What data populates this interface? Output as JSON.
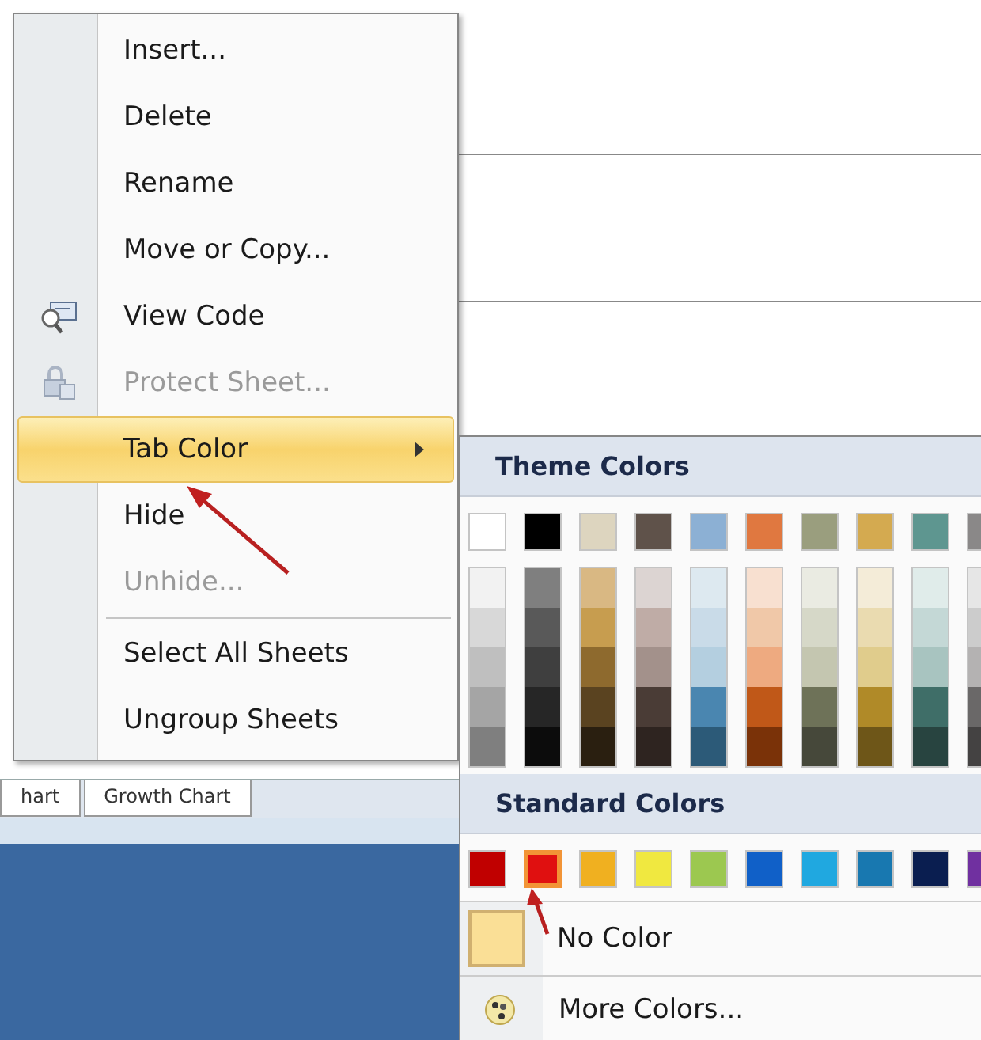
{
  "sheet_tabs": [
    {
      "label": "hart",
      "selected": false
    },
    {
      "label": "Growth Chart",
      "selected": false
    }
  ],
  "context_menu": {
    "items": [
      {
        "kind": "item",
        "label": "Insert...",
        "disabled": false,
        "selected": false,
        "has_submenu": false
      },
      {
        "kind": "item",
        "label": "Delete",
        "disabled": false,
        "selected": false,
        "has_submenu": false
      },
      {
        "kind": "item",
        "label": "Rename",
        "disabled": false,
        "selected": false,
        "has_submenu": false
      },
      {
        "kind": "item",
        "label": "Move or Copy...",
        "disabled": false,
        "selected": false,
        "has_submenu": false
      },
      {
        "kind": "item",
        "label": "View Code",
        "disabled": false,
        "selected": false,
        "has_submenu": false
      },
      {
        "kind": "item",
        "label": "Protect Sheet...",
        "disabled": true,
        "selected": false,
        "has_submenu": false
      },
      {
        "kind": "item",
        "label": "Tab Color",
        "disabled": false,
        "selected": true,
        "has_submenu": true
      },
      {
        "kind": "item",
        "label": "Hide",
        "disabled": false,
        "selected": false,
        "has_submenu": false
      },
      {
        "kind": "item",
        "label": "Unhide...",
        "disabled": true,
        "selected": false,
        "has_submenu": false
      },
      {
        "kind": "separator"
      },
      {
        "kind": "item",
        "label": "Select All Sheets",
        "disabled": false,
        "selected": false,
        "has_submenu": false
      },
      {
        "kind": "item",
        "label": "Ungroup Sheets",
        "disabled": false,
        "selected": false,
        "has_submenu": false
      }
    ]
  },
  "color_submenu": {
    "theme_title": "Theme Colors",
    "theme_colors": [
      {
        "color": "#ffffff",
        "shades": [
          {
            "color": "#f2f2f2"
          },
          {
            "color": "#d8d8d8"
          },
          {
            "color": "#bfbfbf"
          },
          {
            "color": "#a5a5a5"
          },
          {
            "color": "#7f7f7f"
          }
        ]
      },
      {
        "color": "#000000",
        "shades": [
          {
            "color": "#7f7f7f"
          },
          {
            "color": "#595959"
          },
          {
            "color": "#3f3f3f"
          },
          {
            "color": "#262626"
          },
          {
            "color": "#0c0c0c"
          }
        ]
      },
      {
        "color": "#ddd5bf",
        "shades": [
          {
            "color": "#d9b883"
          },
          {
            "color": "#c79d4f"
          },
          {
            "color": "#8e6a2e"
          },
          {
            "color": "#5a4320"
          },
          {
            "color": "#2a1f10"
          }
        ]
      },
      {
        "color": "#5f524a",
        "shades": [
          {
            "color": "#dcd4d2"
          },
          {
            "color": "#bfaca6"
          },
          {
            "color": "#a3918b"
          },
          {
            "color": "#4a3c36"
          },
          {
            "color": "#2e2420"
          }
        ]
      },
      {
        "color": "#8cb0d4",
        "shades": [
          {
            "color": "#dde9f0"
          },
          {
            "color": "#c9dbe8"
          },
          {
            "color": "#b4cfe0"
          },
          {
            "color": "#4a86b0"
          },
          {
            "color": "#2c5a78"
          }
        ]
      },
      {
        "color": "#e07840",
        "shades": [
          {
            "color": "#f8e0d0"
          },
          {
            "color": "#f0c8a8"
          },
          {
            "color": "#eeaa80"
          },
          {
            "color": "#c05818"
          },
          {
            "color": "#7a3208"
          }
        ]
      },
      {
        "color": "#9a9e7e",
        "shades": [
          {
            "color": "#eaebe2"
          },
          {
            "color": "#d6d8c8"
          },
          {
            "color": "#c4c6b0"
          },
          {
            "color": "#6e7258"
          },
          {
            "color": "#46483a"
          }
        ]
      },
      {
        "color": "#d4aa50",
        "shades": [
          {
            "color": "#f4ecd8"
          },
          {
            "color": "#eadbb0"
          },
          {
            "color": "#e0cc8c"
          },
          {
            "color": "#b08a28"
          },
          {
            "color": "#6e5618"
          }
        ]
      },
      {
        "color": "#5e9690",
        "shades": [
          {
            "color": "#e0ecea"
          },
          {
            "color": "#c4d8d6"
          },
          {
            "color": "#a8c4c0"
          },
          {
            "color": "#3f6e68"
          },
          {
            "color": "#284440"
          }
        ]
      },
      {
        "color": "#8a8888",
        "shades": [
          {
            "color": "#e6e6e6"
          },
          {
            "color": "#cccccc"
          },
          {
            "color": "#b4b2b2"
          },
          {
            "color": "#6a6868"
          },
          {
            "color": "#444242"
          }
        ]
      }
    ],
    "standard_title": "Standard Colors",
    "standard_colors": [
      {
        "color": "#c00000",
        "selected": false
      },
      {
        "color": "#e01010",
        "selected": true
      },
      {
        "color": "#f0b020",
        "selected": false
      },
      {
        "color": "#f0e840",
        "selected": false
      },
      {
        "color": "#9cc850",
        "selected": false
      },
      {
        "color": "#1060c8",
        "selected": false
      },
      {
        "color": "#20a8e0",
        "selected": false
      },
      {
        "color": "#1878b0",
        "selected": false
      },
      {
        "color": "#0a1e50",
        "selected": false
      },
      {
        "color": "#7030a0",
        "selected": false
      }
    ],
    "no_color": {
      "label": "No Color",
      "color": "#fadf96"
    },
    "more_colors": {
      "label": "More Colors..."
    }
  }
}
